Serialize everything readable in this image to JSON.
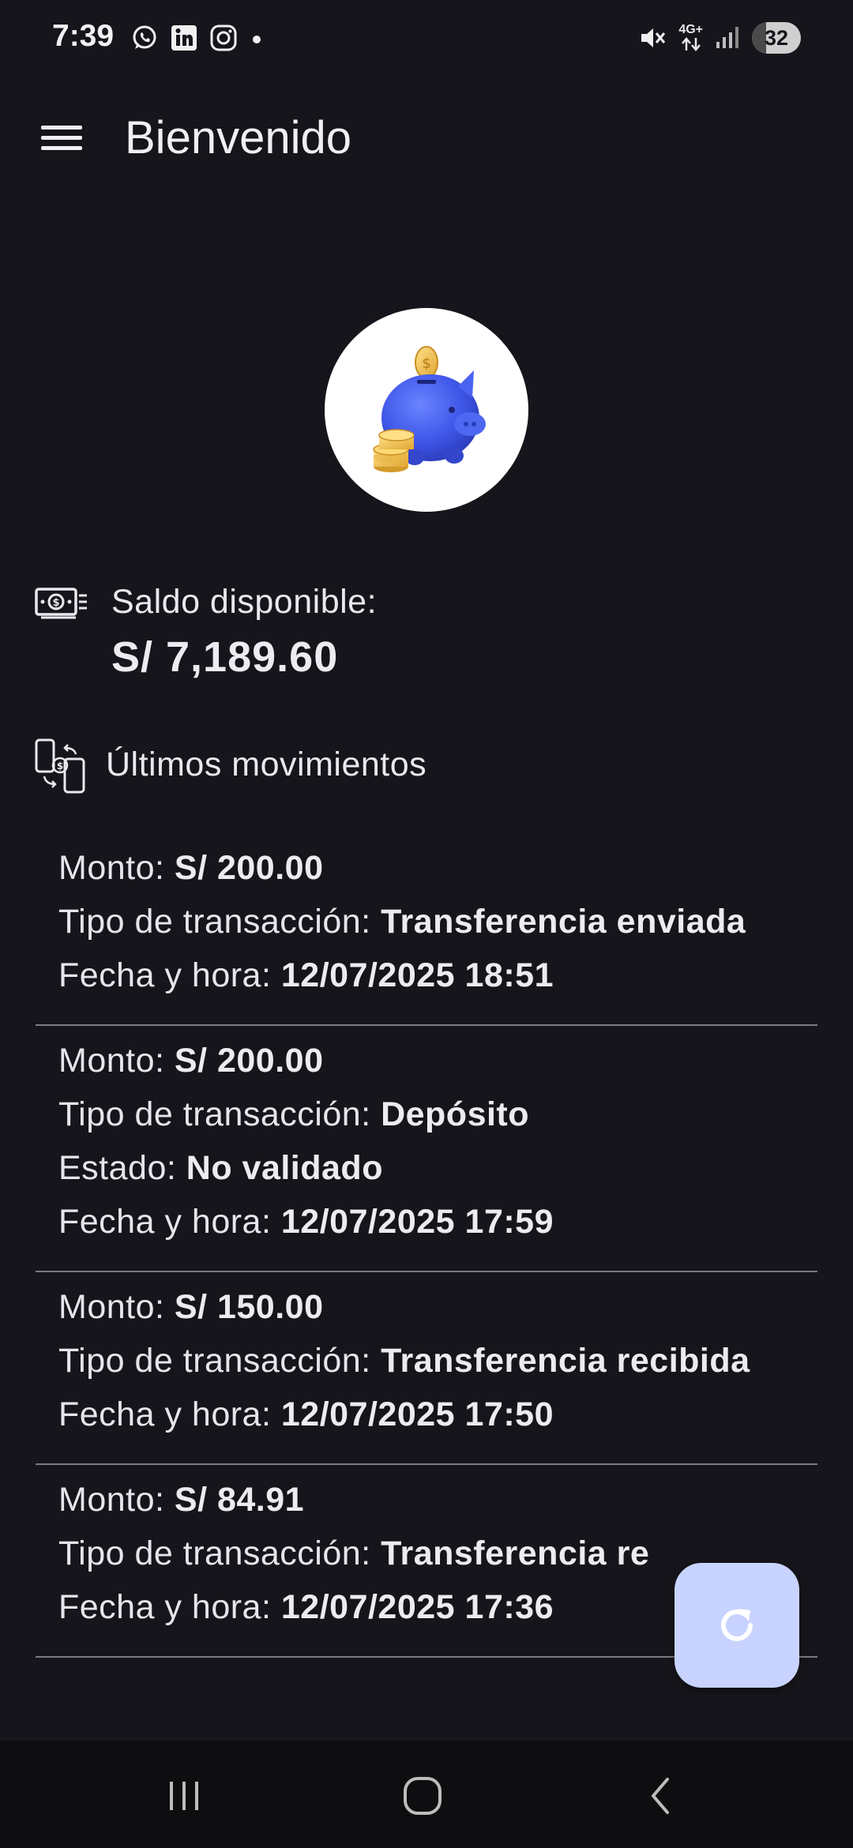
{
  "status_bar": {
    "time": "7:39",
    "battery": "32",
    "network": "4G+",
    "icons_left": [
      "whatsapp-icon",
      "linkedin-icon",
      "instagram-icon",
      "dot-icon"
    ],
    "icons_right": [
      "mute-icon",
      "network-4g-icon",
      "signal-icon",
      "battery-icon"
    ]
  },
  "app_bar": {
    "title": "Bienvenido",
    "menu_icon": "hamburger-menu-icon"
  },
  "avatar": {
    "icon": "piggy-bank-icon"
  },
  "balance": {
    "label": "Saldo disponible:",
    "value": "S/ 7,189.60",
    "icon": "money-icon"
  },
  "movements": {
    "title": "Últimos movimientos",
    "icon": "phone-transfer-icon",
    "items": [
      {
        "lines": [
          {
            "label": "Monto: ",
            "value": "S/ 200.00"
          },
          {
            "label": "Tipo de transacción: ",
            "value": "Transferencia enviada"
          },
          {
            "label": "Fecha y hora: ",
            "value": "12/07/2025 18:51"
          }
        ]
      },
      {
        "lines": [
          {
            "label": "Monto: ",
            "value": "S/ 200.00"
          },
          {
            "label": "Tipo de transacción: ",
            "value": "Depósito"
          },
          {
            "label": "Estado: ",
            "value": "No validado"
          },
          {
            "label": "Fecha y hora: ",
            "value": "12/07/2025 17:59"
          }
        ]
      },
      {
        "lines": [
          {
            "label": "Monto: ",
            "value": "S/ 150.00"
          },
          {
            "label": "Tipo de transacción: ",
            "value": "Transferencia recibida"
          },
          {
            "label": "Fecha y hora: ",
            "value": "12/07/2025 17:50"
          }
        ]
      },
      {
        "lines": [
          {
            "label": "Monto: ",
            "value": "S/ 84.91"
          },
          {
            "label": "Tipo de transacción: ",
            "value": "Transferencia re"
          },
          {
            "label": "Fecha y hora: ",
            "value": "12/07/2025 17:36"
          }
        ]
      }
    ]
  },
  "fab": {
    "icon": "refresh-icon",
    "color": "#c8d3ff"
  },
  "nav_bar": {
    "icons": [
      "recent-apps-icon",
      "home-icon",
      "back-icon"
    ]
  },
  "colors": {
    "background": "#15151b",
    "text": "#ecebf1",
    "divider": "#7b7a82",
    "nav_background": "#0e0e10"
  }
}
